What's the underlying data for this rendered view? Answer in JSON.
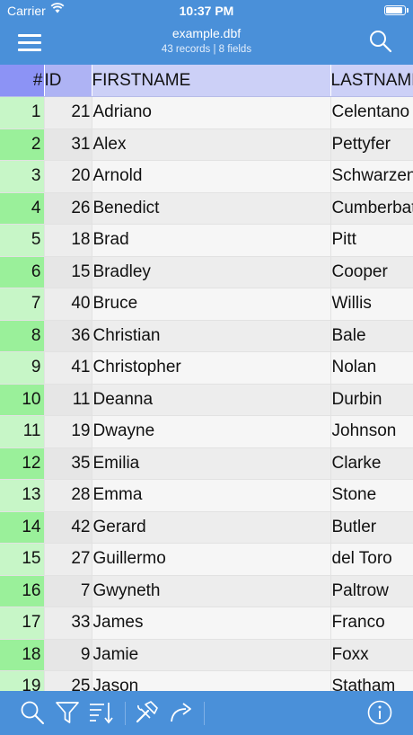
{
  "status_bar": {
    "carrier": "Carrier",
    "time": "10:37 PM",
    "battery_level": 0.95
  },
  "nav": {
    "title": "example.dbf",
    "subtitle": "43 records | 8 fields"
  },
  "table": {
    "headers": {
      "num": "#",
      "id": "ID",
      "firstname": "FIRSTNAME",
      "lastname": "LASTNAME"
    },
    "rows": [
      {
        "num": "1",
        "id": "21",
        "first": "Adriano",
        "last": "Celentano"
      },
      {
        "num": "2",
        "id": "31",
        "first": "Alex",
        "last": "Pettyfer"
      },
      {
        "num": "3",
        "id": "20",
        "first": "Arnold",
        "last": "Schwarzenegger"
      },
      {
        "num": "4",
        "id": "26",
        "first": "Benedict",
        "last": "Cumberbatch"
      },
      {
        "num": "5",
        "id": "18",
        "first": "Brad",
        "last": "Pitt"
      },
      {
        "num": "6",
        "id": "15",
        "first": "Bradley",
        "last": "Cooper"
      },
      {
        "num": "7",
        "id": "40",
        "first": "Bruce",
        "last": "Willis"
      },
      {
        "num": "8",
        "id": "36",
        "first": "Christian",
        "last": "Bale"
      },
      {
        "num": "9",
        "id": "41",
        "first": "Christopher",
        "last": "Nolan"
      },
      {
        "num": "10",
        "id": "11",
        "first": "Deanna",
        "last": "Durbin"
      },
      {
        "num": "11",
        "id": "19",
        "first": "Dwayne",
        "last": "Johnson"
      },
      {
        "num": "12",
        "id": "35",
        "first": "Emilia",
        "last": "Clarke"
      },
      {
        "num": "13",
        "id": "28",
        "first": "Emma",
        "last": "Stone"
      },
      {
        "num": "14",
        "id": "42",
        "first": "Gerard",
        "last": "Butler"
      },
      {
        "num": "15",
        "id": "27",
        "first": "Guillermo",
        "last": "del Toro"
      },
      {
        "num": "16",
        "id": "7",
        "first": "Gwyneth",
        "last": "Paltrow"
      },
      {
        "num": "17",
        "id": "33",
        "first": "James",
        "last": "Franco"
      },
      {
        "num": "18",
        "id": "9",
        "first": "Jamie",
        "last": "Foxx"
      },
      {
        "num": "19",
        "id": "25",
        "first": "Jason",
        "last": "Statham"
      }
    ]
  },
  "toolbar": {
    "icons": [
      "search-icon",
      "filter-icon",
      "sort-icon",
      "tools-icon",
      "share-icon",
      "info-icon"
    ]
  },
  "colors": {
    "accent": "#4a90d9",
    "header_num": "#8c93f5",
    "header": "#ccd0f7",
    "row_num_odd": "#c7f6c7",
    "row_num_even": "#9af09a"
  }
}
